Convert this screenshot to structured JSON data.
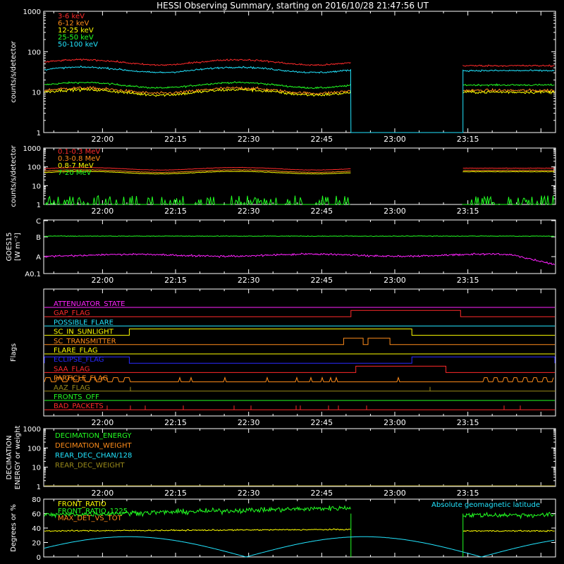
{
  "title": "HESSI Observing Summary, starting on 2016/10/28 21:47:56 UT",
  "colors": {
    "background": "#000000",
    "axis": "#ffffff",
    "red": "#ff2a2a",
    "orange": "#ff8c1a",
    "yellow": "#ffff00",
    "green": "#22ff22",
    "cyan": "#22e5ff",
    "magenta": "#ff22ff",
    "blue": "#2a2aff",
    "olive": "#9a8a1a"
  },
  "time_axis": {
    "start": "21:47:56",
    "end": "23:33:00",
    "tick_labels": [
      "22:00",
      "22:15",
      "22:30",
      "22:45",
      "23:00",
      "23:15"
    ],
    "gap": [
      "22:51",
      "23:14"
    ]
  },
  "chart_data": [
    {
      "type": "line",
      "panel": "count-rates-low",
      "ylabel": "counts/s/detector",
      "yscale": "log",
      "ylim": [
        1,
        1000
      ],
      "y_tick_labels": [
        "1",
        "10",
        "100",
        "1000"
      ],
      "series": [
        {
          "name": "3-6 keV",
          "color": "red",
          "approx_level_before_gap": 55,
          "approx_level_after_gap": 45
        },
        {
          "name": "6-12 keV",
          "color": "orange",
          "approx_level_before_gap": 11,
          "approx_level_after_gap": 11
        },
        {
          "name": "12-25 keV",
          "color": "yellow",
          "approx_level_before_gap": 10,
          "approx_level_after_gap": 10
        },
        {
          "name": "25-50 keV",
          "color": "green",
          "approx_level_before_gap": 15,
          "approx_level_after_gap": 15
        },
        {
          "name": "50-100 keV",
          "color": "cyan",
          "approx_level_before_gap": 36,
          "approx_level_after_gap": 34
        }
      ]
    },
    {
      "type": "line",
      "panel": "count-rates-high",
      "ylabel": "counts/s/detector",
      "yscale": "log",
      "ylim": [
        1,
        1000
      ],
      "y_tick_labels": [
        "1",
        "10",
        "100",
        "1000"
      ],
      "series": [
        {
          "name": "0.1-0.3 MeV",
          "color": "red",
          "approx_level_before_gap": 80,
          "approx_level_after_gap": 85
        },
        {
          "name": "0.3-0.8 MeV",
          "color": "orange",
          "approx_level_before_gap": 60,
          "approx_level_after_gap": 65
        },
        {
          "name": "0.8-7 MeV",
          "color": "yellow",
          "approx_level_before_gap": 50,
          "approx_level_after_gap": 55
        },
        {
          "name": "7-20 MeV",
          "color": "green",
          "approx_level_before_gap": 1.5,
          "approx_level_after_gap": 1.5
        }
      ]
    },
    {
      "type": "line",
      "panel": "goes",
      "ylabel": "GOES15",
      "ylabel2": "[W m⁻²]",
      "y_tick_labels": [
        "A0.1",
        "A",
        "B",
        "C"
      ],
      "series": [
        {
          "color": "green",
          "approx_level": "B"
        },
        {
          "color": "magenta",
          "approx_level": "A"
        }
      ]
    },
    {
      "type": "line",
      "panel": "flags",
      "ylabel": "Flags",
      "flags": [
        {
          "name": "ATTENUATOR_STATE",
          "color": "magenta"
        },
        {
          "name": "GAP_FLAG",
          "color": "red"
        },
        {
          "name": "POSSIBLE_FLARE",
          "color": "cyan"
        },
        {
          "name": "SC_IN_SUNLIGHT",
          "color": "yellow"
        },
        {
          "name": "SC_TRANSMITTER",
          "color": "orange"
        },
        {
          "name": "FLARE_FLAG",
          "color": "yellow"
        },
        {
          "name": "ECLIPSE_FLAG",
          "color": "blue"
        },
        {
          "name": "SAA_FLAG",
          "color": "red"
        },
        {
          "name": "PARTICLE_FLAG",
          "color": "orange"
        },
        {
          "name": "AAZ_FLAG",
          "color": "olive"
        },
        {
          "name": "FRONTS_OFF",
          "color": "green"
        },
        {
          "name": "BAD_PACKETS",
          "color": "red"
        }
      ]
    },
    {
      "type": "line",
      "panel": "decimation",
      "ylabel": "DECIMATION",
      "ylabel2": "ENERGY or weight",
      "yscale": "log",
      "ylim": [
        1,
        1000
      ],
      "y_tick_labels": [
        "1",
        "10",
        "100",
        "1000"
      ],
      "series": [
        {
          "name": "DECIMATION_ENERGY",
          "color": "green"
        },
        {
          "name": "DECIMATION_WEIGHT",
          "color": "orange"
        },
        {
          "name": "REAR_DEC_CHAN/128",
          "color": "cyan"
        },
        {
          "name": "REAR_DEC_WEIGHT",
          "color": "olive"
        }
      ]
    },
    {
      "type": "line",
      "panel": "ratios",
      "ylabel": "Degrees or %",
      "ylim": [
        0,
        80
      ],
      "y_tick_labels": [
        "0",
        "20",
        "40",
        "60",
        "80"
      ],
      "annotation": "Absolute geomagnetic latitude",
      "series": [
        {
          "name": "FRONT_RATIO",
          "color": "yellow",
          "approx_level": 36
        },
        {
          "name": "FRONT_RATIO_1225",
          "color": "green",
          "approx_level": 58
        },
        {
          "name": "MAX_DET_VS_TOT",
          "color": "orange"
        },
        {
          "color": "cyan",
          "approx_peak": 28,
          "approx_min": 0
        }
      ]
    }
  ]
}
